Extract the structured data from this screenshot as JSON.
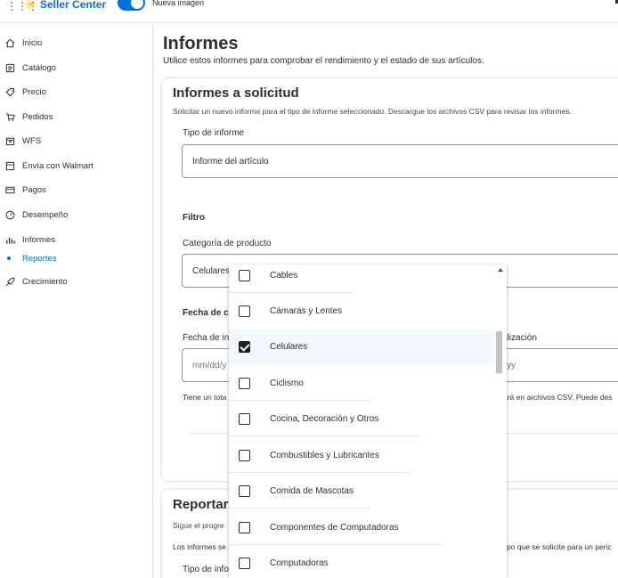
{
  "topbar": {
    "brand": "Seller Center",
    "toggle_label": "Nueva imagen"
  },
  "sidebar": {
    "items": [
      {
        "label": "Inicio",
        "icon": "home-icon"
      },
      {
        "label": "Catálogo",
        "icon": "catalog-icon"
      },
      {
        "label": "Precio",
        "icon": "tag-icon"
      },
      {
        "label": "Pedidos",
        "icon": "cart-icon"
      },
      {
        "label": "WFS",
        "icon": "box-icon"
      },
      {
        "label": "Envía con Walmart",
        "icon": "shipping-icon"
      },
      {
        "label": "Pagos",
        "icon": "card-icon"
      },
      {
        "label": "Desempeño",
        "icon": "gauge-icon"
      },
      {
        "label": "Informes",
        "icon": "bar-chart-icon"
      },
      {
        "label": "Reportes",
        "icon": "dot-icon"
      },
      {
        "label": "Crecimiento",
        "icon": "rocket-icon"
      }
    ]
  },
  "page": {
    "title": "Informes",
    "subtitle": "Utilice estos informes para comprobar el rendimiento y el estado de sus artículos."
  },
  "on_demand": {
    "title": "Informes a solicitud",
    "description": "Solicitar un nuevo informe para el tipo de informe seleccionado. Descargue los archivos CSV para revisar los informes.",
    "report_type_label": "Tipo de informe",
    "report_type_value": "Informe del artículo",
    "filter_label": "Filtro",
    "category_label": "Categoría de producto",
    "category_value": "Celulares",
    "date_label_partial": "Fecha de c",
    "start_date_label_partial": "Fecha de in",
    "end_date_label_partial": "alización",
    "start_date_placeholder": "mm/dd/y",
    "end_date_placeholder": "yy",
    "note_left": "Tiene un tota",
    "note_right": "ará en archivos CSV. Puede des"
  },
  "reports_card": {
    "title_partial": "Reportar",
    "line1_partial": "Sigue el progre",
    "line2_left": "Los informes se",
    "line2_right": "po que se solicite para un peric",
    "type_label_partial": "Tipo de info"
  },
  "category_options": [
    {
      "label": "Cables",
      "checked": false
    },
    {
      "label": "Cámaras y Lentes",
      "checked": false
    },
    {
      "label": "Celulares",
      "checked": true
    },
    {
      "label": "Ciclismo",
      "checked": false
    },
    {
      "label": "Cocina, Decoración y Otros",
      "checked": false
    },
    {
      "label": "Combustibles y Lubricantes",
      "checked": false
    },
    {
      "label": "Comida de Mascotas",
      "checked": false
    },
    {
      "label": "Componentes de Computadoras",
      "checked": false
    },
    {
      "label": "Computadoras",
      "checked": false
    }
  ],
  "colors": {
    "accent": "#0071dc",
    "brand_spark": "#ffc220",
    "selected_row": "#f2f8fd"
  }
}
